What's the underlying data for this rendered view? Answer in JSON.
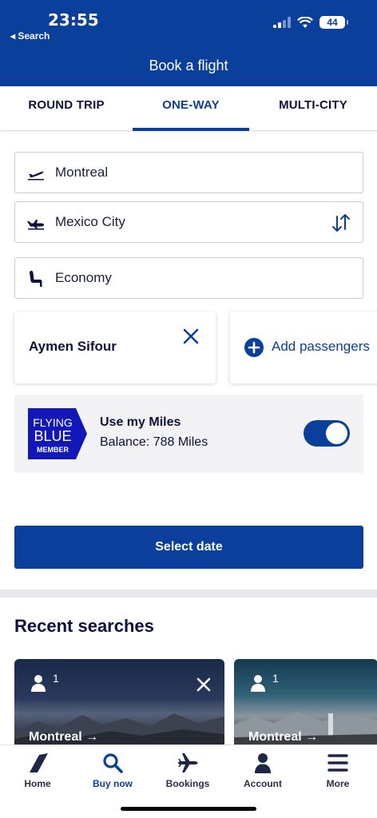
{
  "status_bar": {
    "time": "23:55",
    "back_label": "◂ Search",
    "battery": "44"
  },
  "header": {
    "title": "Book a flight"
  },
  "tabs": [
    {
      "label": "ROUND TRIP",
      "active": false
    },
    {
      "label": "ONE-WAY",
      "active": true
    },
    {
      "label": "MULTI-CITY",
      "active": false
    }
  ],
  "form": {
    "origin": "Montreal",
    "destination": "Mexico City",
    "cabin_class": "Economy"
  },
  "passengers": {
    "selected": [
      "Aymen Sifour"
    ],
    "add_label": "Add passengers"
  },
  "miles": {
    "logo_lines": [
      "FLYING",
      "BLUE",
      "MEMBER"
    ],
    "title": "Use my Miles",
    "balance": "Balance: 788 Miles",
    "enabled": true
  },
  "select_date_label": "Select date",
  "recent_searches": {
    "title": "Recent searches",
    "items": [
      {
        "passengers": "1",
        "route_label": "Montreal →"
      },
      {
        "passengers": "1",
        "route_label": "Montreal →"
      }
    ]
  },
  "bottom_nav": [
    {
      "label": "Home",
      "icon": "airfrance-logo-icon"
    },
    {
      "label": "Buy now",
      "icon": "search-icon",
      "active": true
    },
    {
      "label": "Bookings",
      "icon": "airplane-icon"
    },
    {
      "label": "Account",
      "icon": "person-icon"
    },
    {
      "label": "More",
      "icon": "menu-icon"
    }
  ],
  "colors": {
    "brand": "#0a3f9c",
    "flying_blue": "#1218b8"
  }
}
